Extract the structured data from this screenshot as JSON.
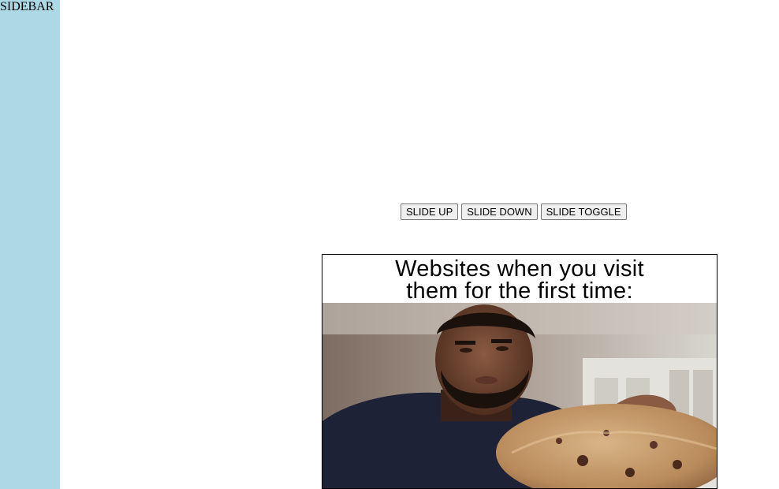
{
  "sidebar": {
    "label": "SIDEBAR",
    "background": "#add8e6"
  },
  "controls": {
    "slide_up": "SLIDE UP",
    "slide_down": "SLIDE DOWN",
    "slide_toggle": "SLIDE TOGGLE"
  },
  "meme": {
    "caption_line1": "Websites when you visit",
    "caption_line2": "them for the first time:"
  }
}
